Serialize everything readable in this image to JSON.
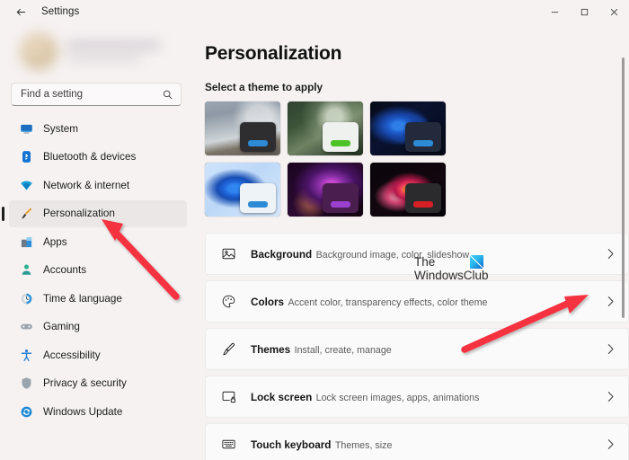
{
  "titlebar": {
    "back_icon": "back-arrow-icon",
    "app_title": "Settings",
    "minimize_label": "─",
    "maximize_label": "☐",
    "close_label": "✕"
  },
  "sidebar": {
    "search": {
      "placeholder": "Find a setting",
      "icon": "search-icon"
    },
    "items": [
      {
        "label": "System",
        "icon": "monitor-icon",
        "active": false
      },
      {
        "label": "Bluetooth & devices",
        "icon": "bluetooth-icon",
        "active": false
      },
      {
        "label": "Network & internet",
        "icon": "wifi-icon",
        "active": false
      },
      {
        "label": "Personalization",
        "icon": "paintbrush-icon",
        "active": true
      },
      {
        "label": "Apps",
        "icon": "apps-icon",
        "active": false
      },
      {
        "label": "Accounts",
        "icon": "person-icon",
        "active": false
      },
      {
        "label": "Time & language",
        "icon": "clock-icon",
        "active": false
      },
      {
        "label": "Gaming",
        "icon": "gamepad-icon",
        "active": false
      },
      {
        "label": "Accessibility",
        "icon": "accessibility-icon",
        "active": false
      },
      {
        "label": "Privacy & security",
        "icon": "shield-icon",
        "active": false
      },
      {
        "label": "Windows Update",
        "icon": "update-icon",
        "active": false
      }
    ]
  },
  "main": {
    "page_title": "Personalization",
    "theme_section_label": "Select a theme to apply",
    "themes": [
      {
        "name": "mountain-theme",
        "wall": "wall-mountain",
        "window_bg": "#2e2e30",
        "accent": "#2d8bd6"
      },
      {
        "name": "forest-theme",
        "wall": "wall-forest",
        "window_bg": "#eef1ee",
        "accent": "#4cc227"
      },
      {
        "name": "bloom-dark-theme",
        "wall": "wall-bloom-dark",
        "window_bg": "#222a3c",
        "accent": "#2d8bd6"
      },
      {
        "name": "bloom-light-theme",
        "wall": "wall-bloom-light",
        "window_bg": "#eef3f8",
        "accent": "#2d8bd6"
      },
      {
        "name": "purple-theme",
        "wall": "wall-purple",
        "window_bg": "#4a1e4e",
        "accent": "#9a3fd0"
      },
      {
        "name": "flower-theme",
        "wall": "wall-flower",
        "window_bg": "#2b2b2e",
        "accent": "#d81f26"
      }
    ],
    "settings": [
      {
        "name": "background",
        "icon": "picture-icon",
        "title": "Background",
        "subtitle": "Background image, color, slideshow",
        "chevron": "›"
      },
      {
        "name": "colors",
        "icon": "palette-icon",
        "title": "Colors",
        "subtitle": "Accent color, transparency effects, color theme",
        "chevron": "›"
      },
      {
        "name": "themes",
        "icon": "brush-icon",
        "title": "Themes",
        "subtitle": "Install, create, manage",
        "chevron": "›"
      },
      {
        "name": "lock-screen",
        "icon": "lock-icon",
        "title": "Lock screen",
        "subtitle": "Lock screen images, apps, animations",
        "chevron": "›"
      },
      {
        "name": "touch-keyboard",
        "icon": "keyboard-icon",
        "title": "Touch keyboard",
        "subtitle": "Themes, size",
        "chevron": "›"
      }
    ]
  },
  "watermark": {
    "line1": "The",
    "line2": "WindowsClub"
  },
  "annotations": {
    "arrow_color": "#F5333F",
    "arrow_count": 2
  }
}
